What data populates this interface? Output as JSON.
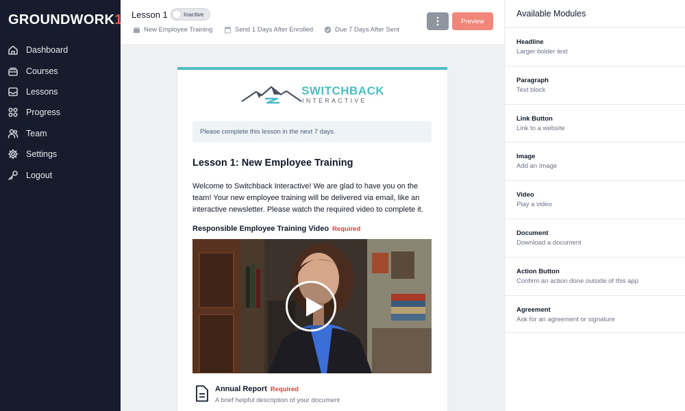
{
  "app": {
    "brand": "GROUNDWORK",
    "brand_mark": "1"
  },
  "sidebar": {
    "items": [
      {
        "label": "Dashboard",
        "icon": "home-icon"
      },
      {
        "label": "Courses",
        "icon": "stack-icon"
      },
      {
        "label": "Lessons",
        "icon": "inbox-icon"
      },
      {
        "label": "Progress",
        "icon": "grid-icon"
      },
      {
        "label": "Team",
        "icon": "users-icon"
      },
      {
        "label": "Settings",
        "icon": "gear-icon"
      },
      {
        "label": "Logout",
        "icon": "key-icon"
      }
    ]
  },
  "header": {
    "title": "Lesson 1",
    "status": "Inactive",
    "meta": [
      {
        "icon": "course-icon",
        "text": "New Employee Training"
      },
      {
        "icon": "calendar-icon",
        "text": "Send 1 Days After Enrolled"
      },
      {
        "icon": "check-circle-icon",
        "text": "Due 7 Days After Sent"
      }
    ],
    "preview_label": "Preview",
    "more_icon": "more-vertical-icon"
  },
  "email": {
    "brand_top": "SWITCHBACK",
    "brand_bottom": "INTERACTIVE",
    "notice": "Please complete this lesson in the next 7 days.",
    "title": "Lesson 1: New Employee Training",
    "intro": "Welcome to Switchback Interactive! We are glad to have you on the team! Your new employee training will be delivered via email, like an interactive newsletter. Please watch the required video to complete it.",
    "video_label": "Responsible Employee Training Video",
    "video_required": "Required",
    "document": {
      "title": "Annual Report",
      "required": "Required",
      "description": "A brief helpful description of your document"
    }
  },
  "modules_panel": {
    "title": "Available Modules",
    "modules": [
      {
        "name": "Headline",
        "desc": "Larger bolder text"
      },
      {
        "name": "Paragraph",
        "desc": "Text block"
      },
      {
        "name": "Link Button",
        "desc": "Link to a website"
      },
      {
        "name": "Image",
        "desc": "Add an Image"
      },
      {
        "name": "Video",
        "desc": "Play a video"
      },
      {
        "name": "Document",
        "desc": "Download a document"
      },
      {
        "name": "Action Button",
        "desc": "Confirm an action done outside of this app"
      },
      {
        "name": "Agreement",
        "desc": "Ask for an agreement or signature"
      }
    ]
  },
  "colors": {
    "sidebar_bg": "#161c2b",
    "accent_teal": "#4dbdc3",
    "preview_button": "#f0877a",
    "required_red": "#d0443c",
    "brand_mark": "#e8594a"
  }
}
